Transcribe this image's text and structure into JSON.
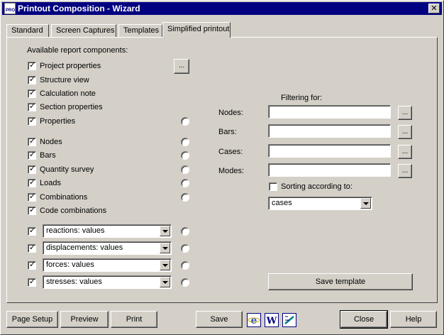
{
  "window": {
    "title": "Printout Composition - Wizard",
    "icon_text": "PRO",
    "close_glyph": "✕"
  },
  "tabs": [
    {
      "label": "Standard"
    },
    {
      "label": "Screen Captures"
    },
    {
      "label": "Templates"
    },
    {
      "label": "Simplified printout",
      "active": true
    }
  ],
  "components": {
    "header": "Available report components:",
    "browse_label": "...",
    "items": [
      {
        "label": "Project properties",
        "checked": true
      },
      {
        "label": "Structure view",
        "checked": true
      },
      {
        "label": "Calculation note",
        "checked": true
      },
      {
        "label": "Section properties",
        "checked": true
      },
      {
        "label": "Properties",
        "checked": true
      },
      {
        "label": "Nodes",
        "checked": true
      },
      {
        "label": "Bars",
        "checked": true
      },
      {
        "label": "Quantity survey",
        "checked": true
      },
      {
        "label": "Loads",
        "checked": true
      },
      {
        "label": "Combinations",
        "checked": true
      },
      {
        "label": "Code combinations",
        "checked": true
      }
    ],
    "results": [
      {
        "value": "reactions: values",
        "checked": true
      },
      {
        "value": "displacements: values",
        "checked": true
      },
      {
        "value": "forces: values",
        "checked": true
      },
      {
        "value": "stresses: values",
        "checked": true
      }
    ]
  },
  "filtering": {
    "header": "Filtering for:",
    "fields": [
      {
        "label": "Nodes:",
        "value": ""
      },
      {
        "label": "Bars:",
        "value": ""
      },
      {
        "label": "Cases:",
        "value": ""
      },
      {
        "label": "Modes:",
        "value": ""
      }
    ],
    "browse_label": "...",
    "sorting_label": "Sorting according to:",
    "sorting_checked": false,
    "sorting_value": "cases"
  },
  "save_template_label": "Save template",
  "footer": {
    "page_setup": "Page Setup",
    "preview": "Preview",
    "print": "Print",
    "save": "Save",
    "close": "Close",
    "help": "Help"
  },
  "colors": {
    "title_bar": "#000080",
    "face": "#d4d0c8"
  }
}
